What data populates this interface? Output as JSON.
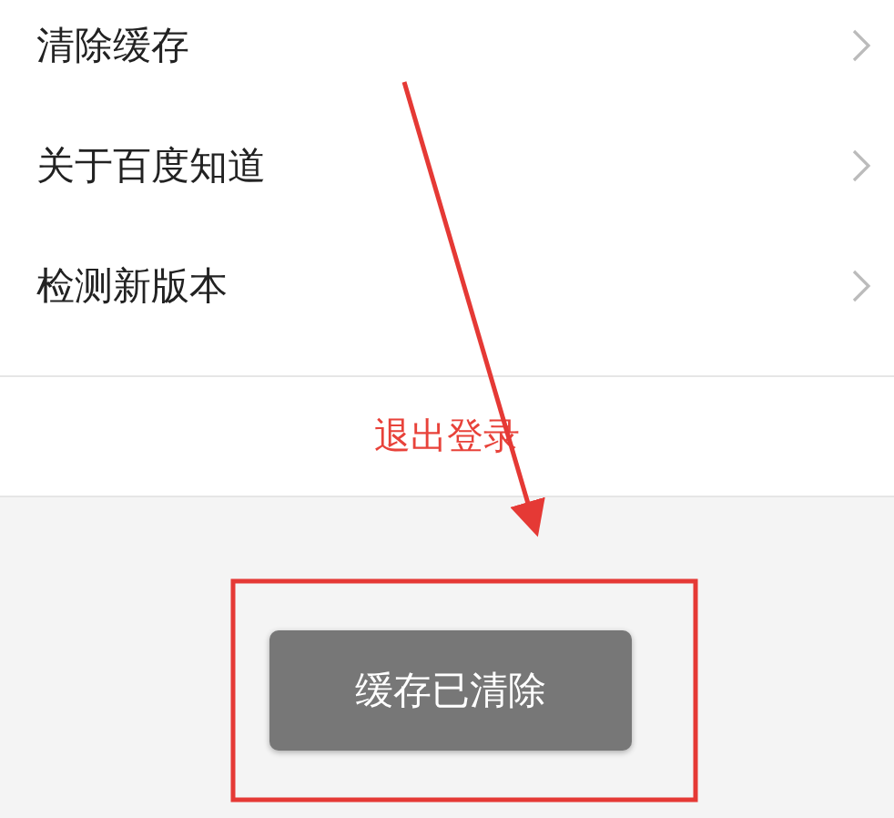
{
  "settings_items": [
    {
      "label": "清除缓存"
    },
    {
      "label": "关于百度知道"
    },
    {
      "label": "检测新版本"
    }
  ],
  "logout": {
    "label": "退出登录"
  },
  "toast": {
    "text": "缓存已清除"
  }
}
